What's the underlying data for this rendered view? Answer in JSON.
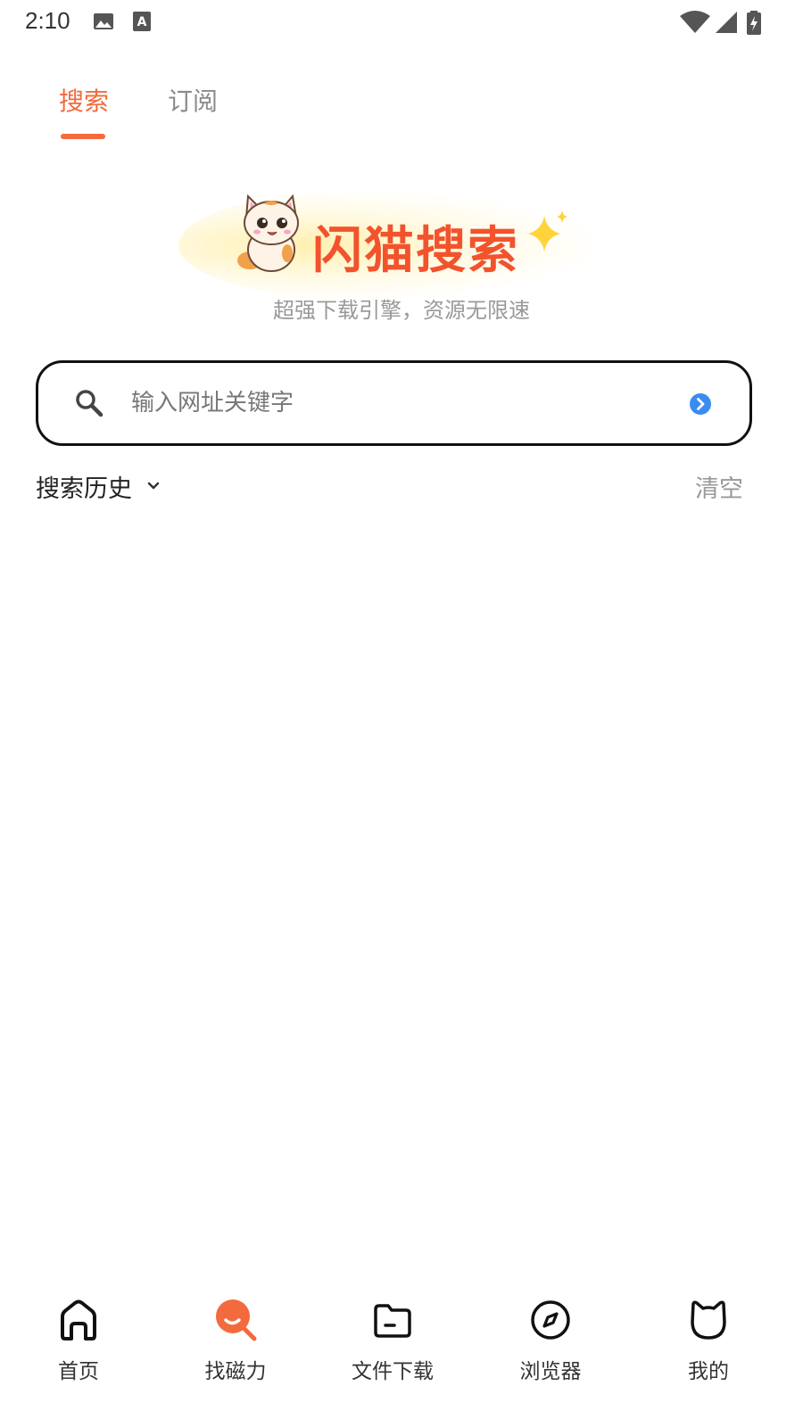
{
  "status_bar": {
    "time": "2:10",
    "icons": [
      "image-icon",
      "text-a-icon",
      "wifi-icon",
      "cell-signal-icon",
      "battery-charging-icon"
    ]
  },
  "tabs": [
    {
      "label": "搜索",
      "active": true
    },
    {
      "label": "订阅",
      "active": false
    }
  ],
  "hero": {
    "title": "闪猫搜索",
    "tagline": "超强下载引擎，资源无限速"
  },
  "search": {
    "placeholder": "输入网址关键字",
    "value": ""
  },
  "history": {
    "label": "搜索历史",
    "clear_label": "清空"
  },
  "bottom_nav": [
    {
      "label": "首页",
      "icon": "home-icon"
    },
    {
      "label": "找磁力",
      "icon": "magnet-search-icon",
      "active": true
    },
    {
      "label": "文件下载",
      "icon": "folder-icon"
    },
    {
      "label": "浏览器",
      "icon": "compass-icon"
    },
    {
      "label": "我的",
      "icon": "cat-face-icon"
    }
  ],
  "colors": {
    "accent": "#f26a3d",
    "brand_title": "#f2532d",
    "go_button": "#3b8cf0",
    "muted_text": "#999999"
  }
}
